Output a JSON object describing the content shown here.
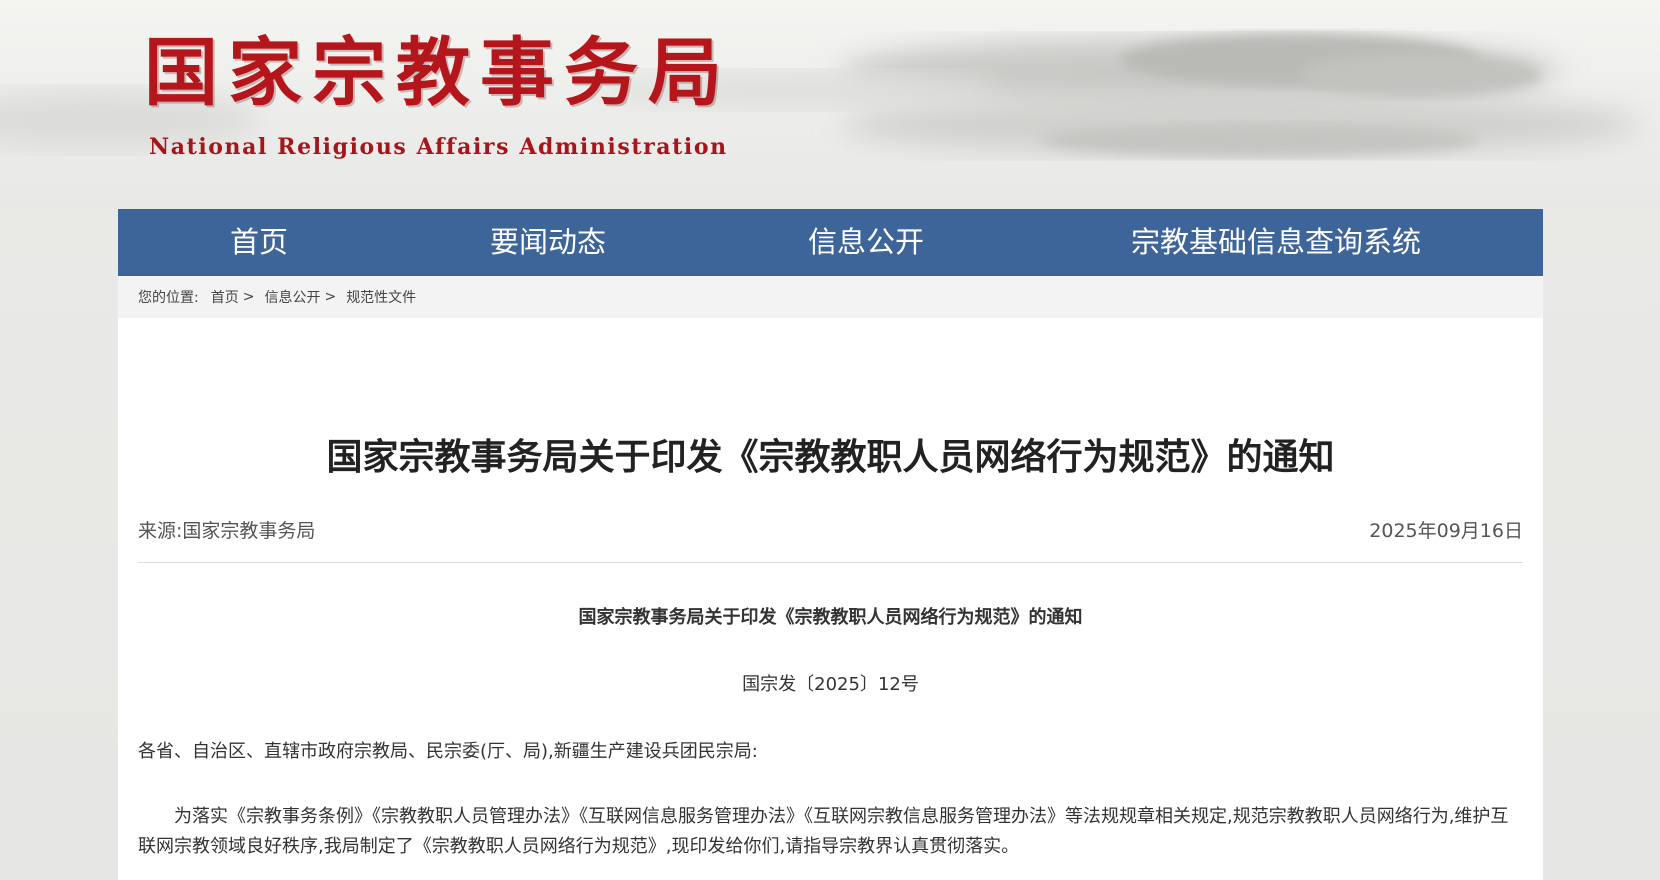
{
  "header": {
    "logo_cn": "国家宗教事务局",
    "logo_en": "National Religious Affairs Administration"
  },
  "nav": {
    "items": [
      {
        "label": "首页"
      },
      {
        "label": "要闻动态"
      },
      {
        "label": "信息公开"
      },
      {
        "label": "宗教基础信息查询系统"
      }
    ]
  },
  "breadcrumb": {
    "prefix": "您的位置:",
    "items": [
      "首页",
      "信息公开",
      "规范性文件"
    ],
    "separator": ">"
  },
  "article": {
    "title": "国家宗教事务局关于印发《宗教教职人员网络行为规范》的通知",
    "source": "来源:国家宗教事务局",
    "date": "2025年09月16日",
    "doc_title": "国家宗教事务局关于印发《宗教教职人员网络行为规范》的通知",
    "doc_number": "国宗发〔2025〕12号",
    "salutation": "各省、自治区、直辖市政府宗教局、民宗委(厅、局),新疆生产建设兵团民宗局:",
    "paragraph": "为落实《宗教事务条例》《宗教教职人员管理办法》《互联网信息服务管理办法》《互联网宗教信息服务管理办法》等法规规章相关规定,规范宗教教职人员网络行为,维护互联网宗教领域良好秩序,我局制定了《宗教教职人员网络行为规范》,现印发给你们,请指导宗教界认真贯彻落实。"
  },
  "colors": {
    "nav_bg": "#3d6599",
    "logo_red": "#b4161b"
  }
}
